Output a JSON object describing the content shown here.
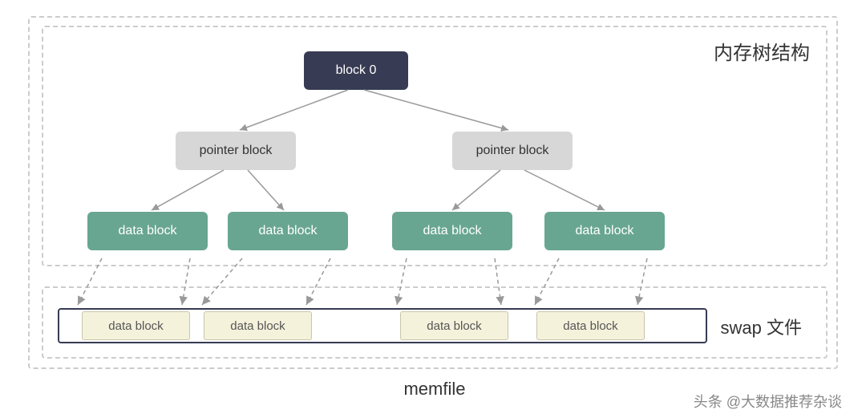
{
  "labels": {
    "tree_title": "内存树结构",
    "swap_title": "swap 文件",
    "memfile": "memfile",
    "watermark": "头条 @大数据推荐杂谈"
  },
  "nodes": {
    "root": "block 0",
    "pointer1": "pointer block",
    "pointer2": "pointer block",
    "data1": "data block",
    "data2": "data block",
    "data3": "data block",
    "data4": "data block"
  },
  "swap": {
    "block1": "data block",
    "block2": "data block",
    "block3": "data block",
    "block4": "data block"
  }
}
